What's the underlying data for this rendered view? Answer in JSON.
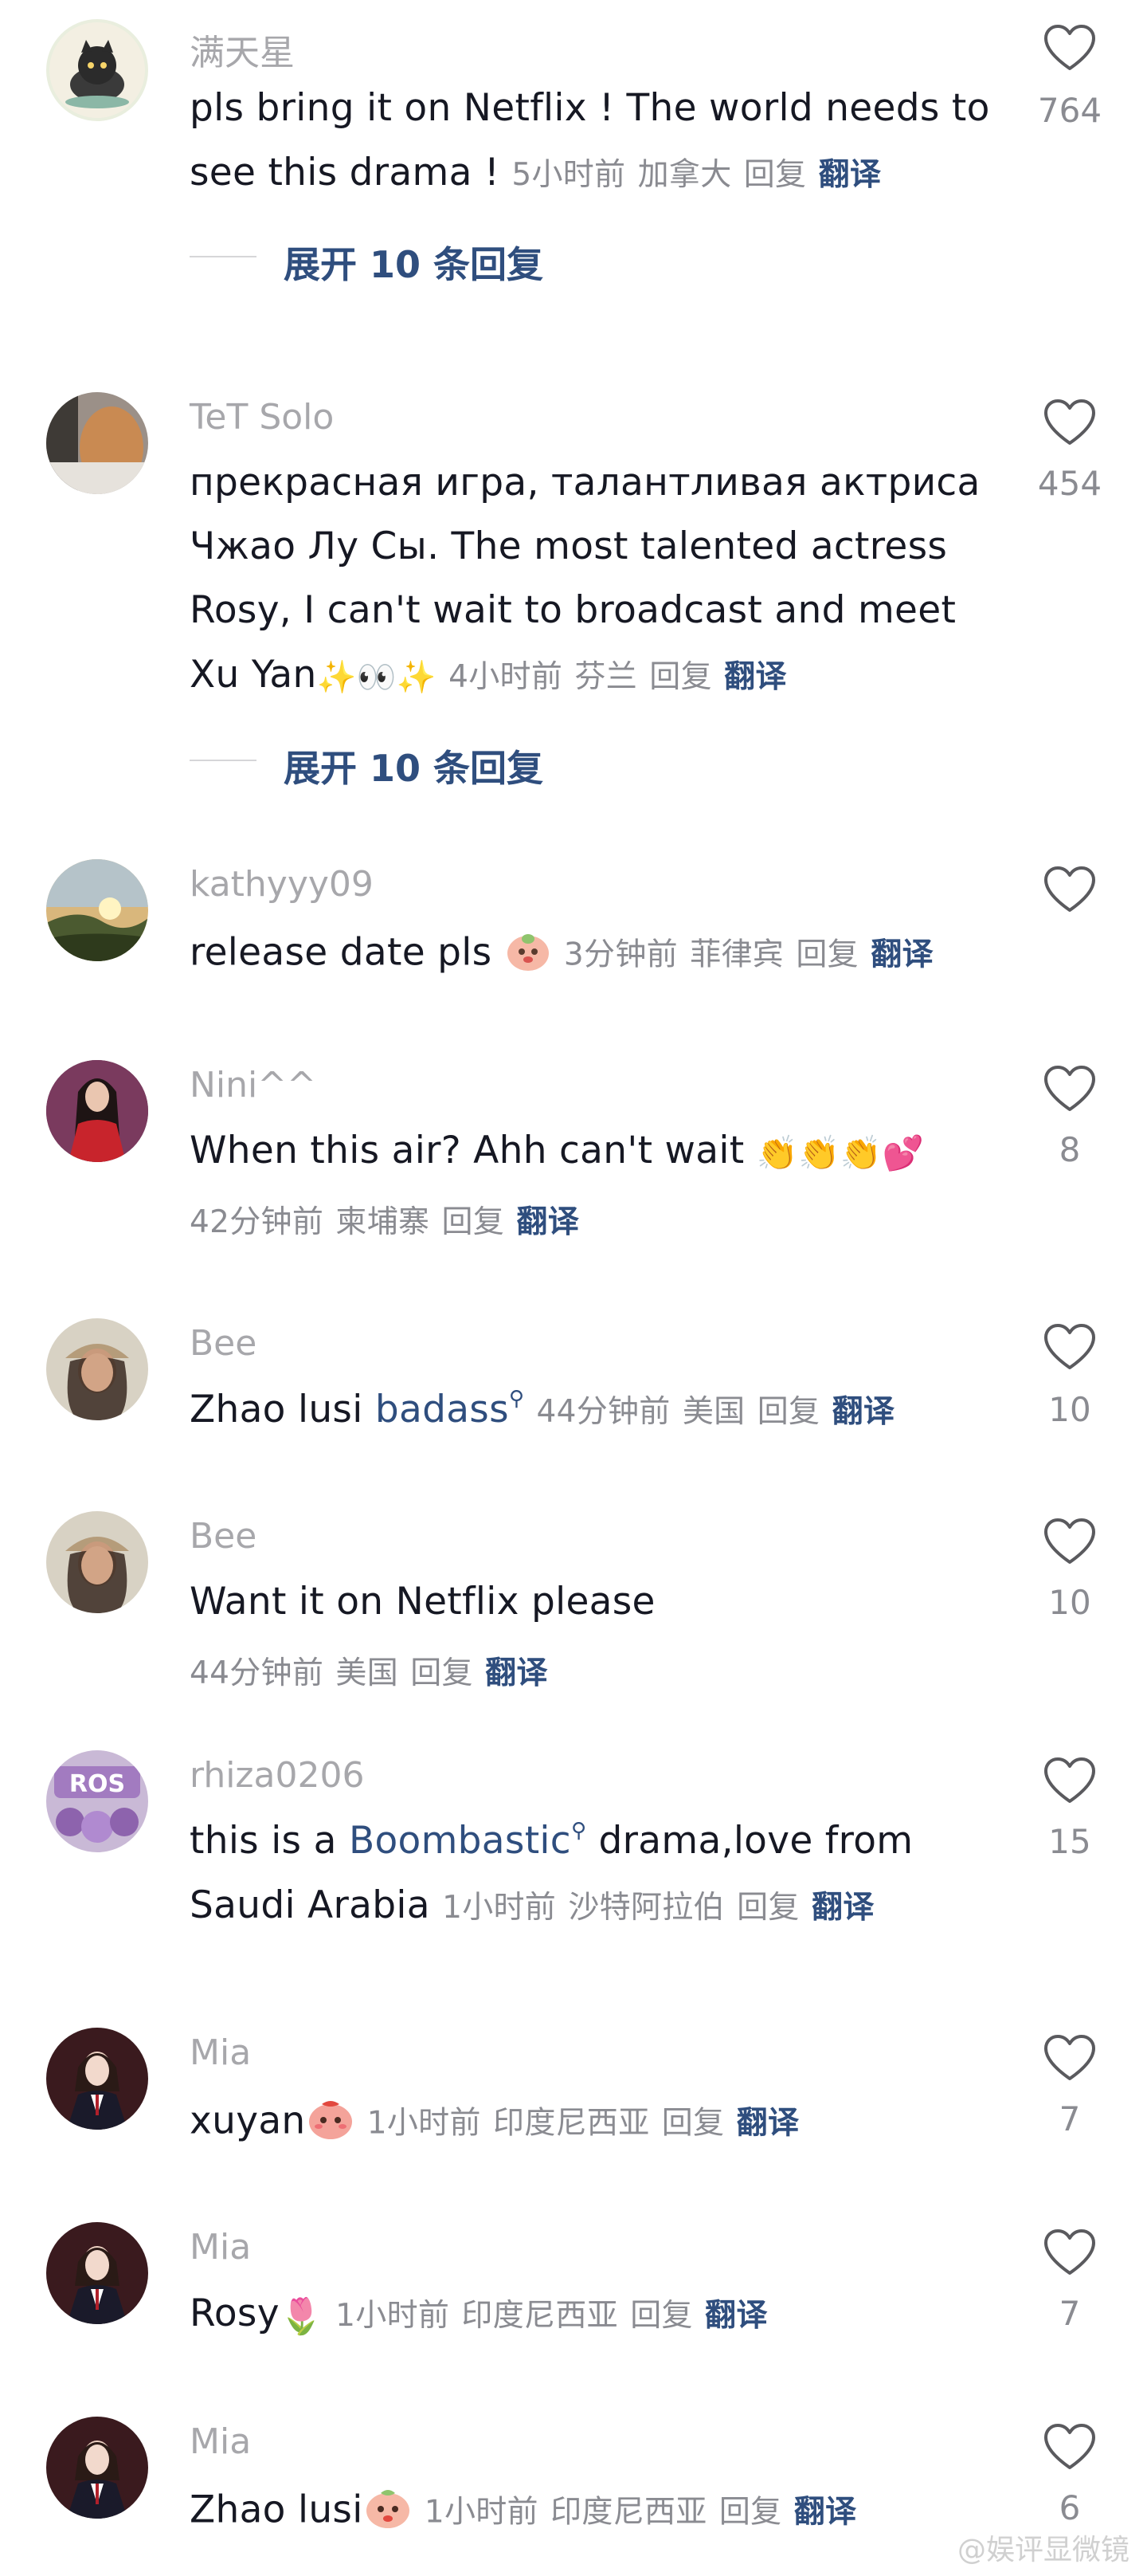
{
  "comments": [
    {
      "username": "满天星",
      "lines": [
        "pls bring it on Netflix ! The world needs to",
        "see this drama ! "
      ],
      "time": "5小时前",
      "location": "加拿大",
      "likes": "764",
      "expand": "展开 10 条回复"
    },
    {
      "username": "TeT Solo",
      "lines": [
        "прекрасная игра, талантливая актриса",
        "Чжао Лу Сы. The most talented actress",
        "Rosy, I can't wait to broadcast and meet",
        "Xu Yan"
      ],
      "emoji": "✨👀✨",
      "time": "4小时前",
      "location": "芬兰",
      "likes": "454",
      "expand": "展开 10 条回复"
    },
    {
      "username": "kathyyy09",
      "lines": [
        "release date pls "
      ],
      "time": "3分钟前",
      "location": "菲律宾",
      "likes": ""
    },
    {
      "username": "Nini^^",
      "lines": [
        "When this air? Ahh can't wait "
      ],
      "emoji": "👏👏👏💕",
      "time": "42分钟前",
      "location": "柬埔寨",
      "likes": "8"
    },
    {
      "username": "Bee",
      "lines": [
        "Zhao lusi "
      ],
      "tag": "badass",
      "time": "44分钟前",
      "location": "美国",
      "likes": "10"
    },
    {
      "username": "Bee",
      "lines": [
        "Want it on Netflix please"
      ],
      "time": "44分钟前",
      "location": "美国",
      "likes": "10"
    },
    {
      "username": "rhiza0206",
      "lines": [
        "this is a ",
        "drama,love from",
        "Saudi Arabia"
      ],
      "tag": "Boombastic",
      "time": "1小时前",
      "location": "沙特阿拉伯",
      "likes": "15"
    },
    {
      "username": "Mia",
      "lines": [
        "xuyan"
      ],
      "time": "1小时前",
      "location": "印度尼西亚",
      "likes": "7"
    },
    {
      "username": "Mia",
      "lines": [
        "Rosy"
      ],
      "emoji": "🌷",
      "time": "1小时前",
      "location": "印度尼西亚",
      "likes": "7"
    },
    {
      "username": "Mia",
      "lines": [
        "Zhao lusi"
      ],
      "time": "1小时前",
      "location": "印度尼西亚",
      "likes": "6"
    }
  ],
  "labels": {
    "reply": "回复",
    "translate": "翻译"
  },
  "watermark": "@娱评显微镜",
  "colors": {
    "link": "#2f4e7e",
    "username": "#a7a7ab",
    "meta": "#8a8b91",
    "text": "#161823"
  }
}
